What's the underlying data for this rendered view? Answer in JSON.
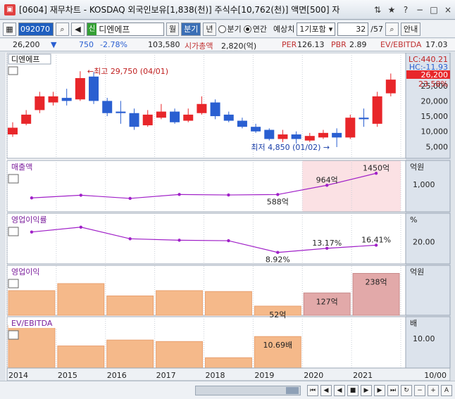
{
  "window": {
    "title": "[0604] 재무차트 - KOSDAQ 외국인보유[1,838(천)] 주식수[10,762(천)] 액면[500] 자",
    "controls": [
      "⇅",
      "★",
      "?",
      "−",
      "□",
      "×"
    ]
  },
  "toolbar": {
    "code": "092070",
    "name_tag": "신",
    "name": "디엔에프",
    "tabs": [
      "월",
      "분기",
      "년"
    ],
    "active_tab": "분기",
    "radio_quarter": "분기",
    "radio_annual": "연간",
    "forecast_label": "예상치",
    "forecast_value": "1기포함",
    "page": "32",
    "page_total": "/57",
    "guide": "안내"
  },
  "info": {
    "price": "26,200",
    "change": "750",
    "change_pct": "-2.78%",
    "volume": "103,580",
    "mcap_label": "시가총액",
    "mcap": "2,820(억)",
    "per_label": "PER",
    "per": "126.13",
    "pbr_label": "PBR",
    "pbr": "2.89",
    "ev_label": "EV/EBITDA",
    "ev": "17.03"
  },
  "chart_data": [
    {
      "type": "candlestick",
      "title": "디엔에프",
      "y_ticks": [
        "25,000",
        "20,000",
        "15,000",
        "10,000",
        "5,000"
      ],
      "ylim": [
        3000,
        33500
      ],
      "high_label": "최고 29,750 (04/01)",
      "low_label": "최저 4,850 (01/02)",
      "lc_label": "LC:440.21",
      "hc_label": "HC:-11.93",
      "last_price": "26,200",
      "last_pct": "23.58%",
      "candles": [
        {
          "o": 9000,
          "c": 11200,
          "h": 13000,
          "l": 8200,
          "up": true
        },
        {
          "o": 12500,
          "c": 15500,
          "h": 17000,
          "l": 12000,
          "up": true
        },
        {
          "o": 17000,
          "c": 21500,
          "h": 23000,
          "l": 16000,
          "up": true
        },
        {
          "o": 19500,
          "c": 21500,
          "h": 23000,
          "l": 18500,
          "up": true
        },
        {
          "o": 21000,
          "c": 20000,
          "h": 24000,
          "l": 18500,
          "up": false
        },
        {
          "o": 20500,
          "c": 27500,
          "h": 29750,
          "l": 20000,
          "up": true
        },
        {
          "o": 28000,
          "c": 20000,
          "h": 29500,
          "l": 19000,
          "up": false
        },
        {
          "o": 20000,
          "c": 16000,
          "h": 21000,
          "l": 15000,
          "up": false
        },
        {
          "o": 16500,
          "c": 16000,
          "h": 20000,
          "l": 12500,
          "up": false
        },
        {
          "o": 16000,
          "c": 11500,
          "h": 17500,
          "l": 10500,
          "up": false
        },
        {
          "o": 12000,
          "c": 15500,
          "h": 17000,
          "l": 11500,
          "up": true
        },
        {
          "o": 14500,
          "c": 16500,
          "h": 19000,
          "l": 14000,
          "up": true
        },
        {
          "o": 16500,
          "c": 13000,
          "h": 17500,
          "l": 12500,
          "up": false
        },
        {
          "o": 13500,
          "c": 15500,
          "h": 17500,
          "l": 13000,
          "up": true
        },
        {
          "o": 16000,
          "c": 19000,
          "h": 21500,
          "l": 15500,
          "up": true
        },
        {
          "o": 19500,
          "c": 15000,
          "h": 20500,
          "l": 14000,
          "up": false
        },
        {
          "o": 15500,
          "c": 13500,
          "h": 16500,
          "l": 13000,
          "up": false
        },
        {
          "o": 13500,
          "c": 11500,
          "h": 14500,
          "l": 11000,
          "up": false
        },
        {
          "o": 11500,
          "c": 10000,
          "h": 12500,
          "l": 9500,
          "up": false
        },
        {
          "o": 10500,
          "c": 7500,
          "h": 11000,
          "l": 7000,
          "up": false
        },
        {
          "o": 7500,
          "c": 9000,
          "h": 10500,
          "l": 6500,
          "up": true
        },
        {
          "o": 9000,
          "c": 7500,
          "h": 10000,
          "l": 6000,
          "up": false
        },
        {
          "o": 7000,
          "c": 8500,
          "h": 9500,
          "l": 6500,
          "up": true
        },
        {
          "o": 8000,
          "c": 9500,
          "h": 10500,
          "l": 7500,
          "up": true
        },
        {
          "o": 9500,
          "c": 8000,
          "h": 11000,
          "l": 4850,
          "up": false
        },
        {
          "o": 8000,
          "c": 14500,
          "h": 15500,
          "l": 7500,
          "up": true
        },
        {
          "o": 14500,
          "c": 14000,
          "h": 17500,
          "l": 11500,
          "up": false
        },
        {
          "o": 12500,
          "c": 21500,
          "h": 23000,
          "l": 11500,
          "up": true
        },
        {
          "o": 22500,
          "c": 27000,
          "h": 29000,
          "l": 21500,
          "up": true
        }
      ]
    },
    {
      "type": "line",
      "title": "매출액",
      "unit": "억원",
      "y_ticks": [
        "1,000"
      ],
      "x": [
        2014,
        2015,
        2016,
        2017,
        2018,
        2019,
        2020,
        2021
      ],
      "values": [
        450,
        560,
        430,
        590,
        570,
        588,
        964,
        1450
      ],
      "labels": [
        "",
        "",
        "",
        "",
        "",
        "588억",
        "964억",
        "1450억"
      ],
      "ylim": [
        0,
        1800
      ]
    },
    {
      "type": "line",
      "title": "영업이익률",
      "unit": "%",
      "y_ticks": [
        "20.00"
      ],
      "x": [
        2014,
        2015,
        2016,
        2017,
        2018,
        2019,
        2020,
        2021
      ],
      "values": [
        30,
        35,
        23,
        21.5,
        21,
        8.92,
        13.17,
        16.41
      ],
      "labels": [
        "",
        "",
        "",
        "",
        "",
        "8.92%",
        "13.17%",
        "16.41%"
      ],
      "ylim": [
        0,
        45
      ]
    },
    {
      "type": "bar",
      "title": "영업이익",
      "unit": "억원",
      "x": [
        2014,
        2015,
        2016,
        2017,
        2018,
        2019,
        2020,
        2021
      ],
      "values": [
        140,
        180,
        110,
        140,
        135,
        52,
        127,
        238
      ],
      "labels": [
        "",
        "",
        "",
        "",
        "",
        "52억",
        "127억",
        "238억"
      ],
      "ylim": [
        0,
        260
      ]
    },
    {
      "type": "bar",
      "title": "EV/EBITDA",
      "unit": "배",
      "y_ticks": [
        "10.00"
      ],
      "x": [
        2014,
        2015,
        2016,
        2017,
        2018,
        2019,
        2020,
        2021
      ],
      "values": [
        14.5,
        7.5,
        9.5,
        9.0,
        3.5,
        10.69,
        0,
        0
      ],
      "labels": [
        "",
        "",
        "",
        "",
        "",
        "10.69배",
        "",
        ""
      ],
      "ylim": [
        0,
        16
      ]
    }
  ],
  "x_axis": {
    "labels": [
      "2014",
      "2015",
      "2016",
      "2017",
      "2018",
      "2019",
      "2020",
      "2021"
    ],
    "right_label": "10/00"
  },
  "colors": {
    "up": "#e8262a",
    "down": "#2a5fd1",
    "line": "#a020c8",
    "bar": "#f5b98a",
    "bar_hl": "#e2a9a9",
    "highlight": "#fbe1e4",
    "axis_bg": "#dce3ec"
  }
}
